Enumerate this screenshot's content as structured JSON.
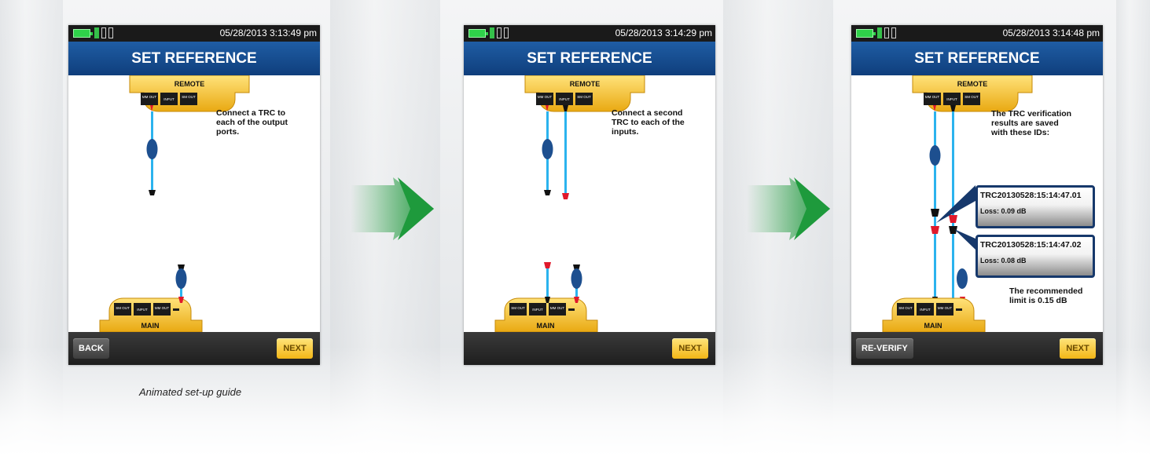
{
  "panels": [
    {
      "timestamp": "05/28/2013 3:13:49 pm",
      "title": "SET REFERENCE",
      "remote_label": "REMOTE",
      "remote_ports": [
        "MM OUT",
        "INPUT",
        "SM OUT"
      ],
      "main_label": "MAIN",
      "main_ports": [
        "SM OUT",
        "INPUT",
        "MM OUT"
      ],
      "instruction": [
        "Connect a TRC to",
        "each of the output",
        "ports."
      ],
      "back_label": "BACK",
      "next_label": "NEXT"
    },
    {
      "timestamp": "05/28/2013 3:14:29 pm",
      "title": "SET REFERENCE",
      "remote_label": "REMOTE",
      "remote_ports": [
        "MM OUT",
        "INPUT",
        "SM OUT"
      ],
      "main_label": "MAIN",
      "main_ports": [
        "SM OUT",
        "INPUT",
        "MM OUT"
      ],
      "instruction": [
        "Connect a second",
        "TRC to each of the",
        "inputs."
      ],
      "next_label": "NEXT"
    },
    {
      "timestamp": "05/28/2013 3:14:48 pm",
      "title": "SET REFERENCE",
      "remote_label": "REMOTE",
      "remote_ports": [
        "MM OUT",
        "INPUT",
        "SM OUT"
      ],
      "main_label": "MAIN",
      "main_ports": [
        "SM OUT",
        "INPUT",
        "MM OUT"
      ],
      "instruction": [
        "The TRC verification",
        "results are saved",
        "with these IDs:"
      ],
      "results": [
        {
          "id": "TRC20130528:15:14:47.01",
          "loss": "Loss: 0.09 dB"
        },
        {
          "id": "TRC20130528:15:14:47.02",
          "loss": "Loss: 0.08 dB"
        }
      ],
      "limit_text": [
        "The recommended",
        "limit is 0.15 dB"
      ],
      "reverify_label": "RE-VERIFY",
      "next_label": "NEXT"
    }
  ],
  "caption": "Animated set-up guide",
  "colors": {
    "title_blue": "#124684",
    "arrow_green": "#1e9a3c",
    "cable_blue": "#2bb3ee",
    "connector_red": "#e0192b",
    "module_yellow": "#f2c230"
  }
}
